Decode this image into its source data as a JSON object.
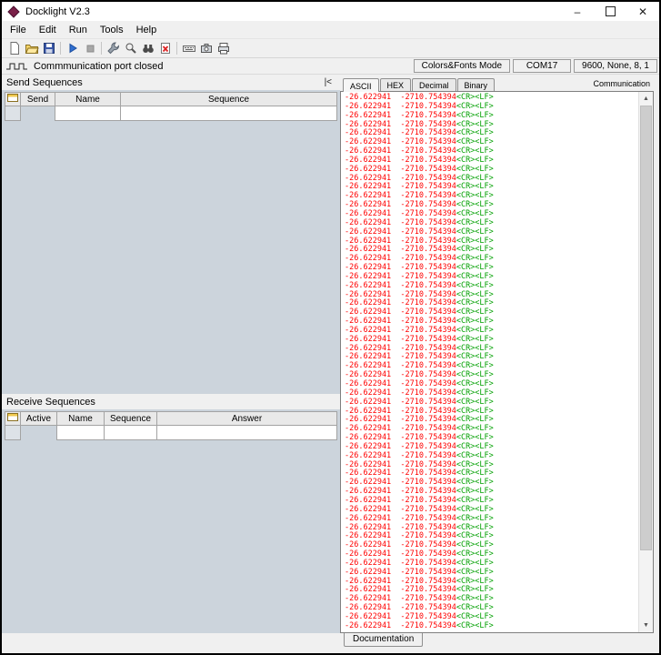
{
  "window": {
    "title": "Docklight V2.3",
    "controls": [
      "minimize",
      "maximize",
      "close"
    ]
  },
  "menu": {
    "items": [
      "File",
      "Edit",
      "Run",
      "Tools",
      "Help"
    ]
  },
  "toolbar": {
    "icons": [
      "new-project",
      "open-project",
      "save-project",
      "start-communication",
      "stop-communication",
      "project-settings",
      "find-zoom",
      "find-sequence",
      "clear-communication-window",
      "keyboard-console",
      "communication-snapshot",
      "print-communication"
    ]
  },
  "status": {
    "message": "Commmunication port closed",
    "colors_fonts_mode": "Colors&Fonts Mode",
    "com_port": "COM17",
    "com_settings": "9600, None, 8, 1"
  },
  "send_sequences": {
    "title": "Send Sequences",
    "collapse_button": "|<",
    "columns": [
      "Send",
      "Name",
      "Sequence"
    ]
  },
  "receive_sequences": {
    "title": "Receive Sequences",
    "columns": [
      "Active",
      "Name",
      "Sequence",
      "Answer"
    ]
  },
  "communication": {
    "tabs": [
      "ASCII",
      "HEX",
      "Decimal",
      "Binary"
    ],
    "active_tab": "ASCII",
    "panel_label": "Communication",
    "lines": {
      "count": 60,
      "values": "-26.622941  -2710.754394",
      "control_chars": "<CR><LF>",
      "value_color": "#ff0000",
      "control_color": "#00a000"
    }
  },
  "bottom_tabs": {
    "documentation": "Documentation"
  }
}
